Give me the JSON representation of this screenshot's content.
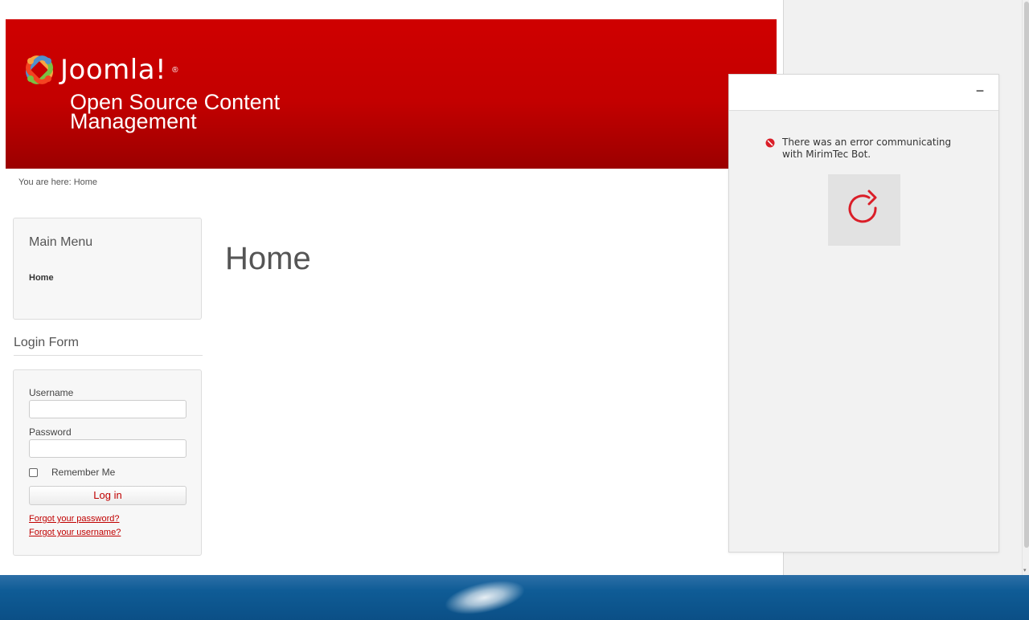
{
  "site": {
    "brand_name": "Joomla!",
    "brand_mark": "®",
    "description": "Open Source Content Management",
    "breadcrumb": "You are here: Home"
  },
  "sidebar": {
    "main_menu": {
      "title": "Main Menu",
      "items": [
        {
          "label": "Home"
        }
      ]
    },
    "login_form": {
      "title": "Login Form",
      "username_label": "Username",
      "username_value": "",
      "password_label": "Password",
      "password_value": "",
      "remember_label": "Remember Me",
      "login_button": "Log in",
      "forgot_password": "Forgot your password?",
      "forgot_username": "Forgot your username?"
    }
  },
  "main": {
    "title": "Home"
  },
  "chatbot": {
    "minimize_label": "−",
    "error_message": "There was an error communicating with MirimTec Bot.",
    "retry_icon": "refresh-icon"
  },
  "colors": {
    "header_red": "#c30000",
    "accent_red": "#c00000",
    "panel_bg": "#f2f2f2",
    "desktop_blue": "#0f5c96"
  }
}
